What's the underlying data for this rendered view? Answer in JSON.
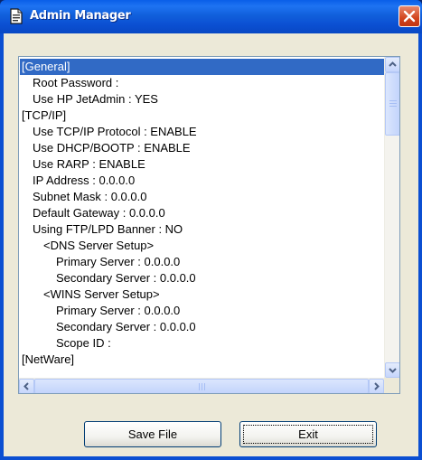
{
  "window": {
    "title": "Admin Manager",
    "colors": {
      "titlebar": "#0b4fd2",
      "selection": "#316ac5",
      "client": "#ece9d8",
      "close": "#d2451e"
    },
    "icons": {
      "title": "document-icon",
      "close": "close-icon"
    }
  },
  "list": {
    "items": [
      {
        "text": "[General]",
        "level": 0,
        "selected": true
      },
      {
        "text": "Root Password :",
        "level": 1
      },
      {
        "text": "Use HP JetAdmin : YES",
        "level": 1
      },
      {
        "text": "[TCP/IP]",
        "level": 0
      },
      {
        "text": "Use TCP/IP Protocol : ENABLE",
        "level": 1
      },
      {
        "text": "Use DHCP/BOOTP : ENABLE",
        "level": 1
      },
      {
        "text": "Use RARP : ENABLE",
        "level": 1
      },
      {
        "text": "IP Address : 0.0.0.0",
        "level": 1
      },
      {
        "text": "Subnet Mask : 0.0.0.0",
        "level": 1
      },
      {
        "text": "Default Gateway : 0.0.0.0",
        "level": 1
      },
      {
        "text": "Using FTP/LPD Banner : NO",
        "level": 1
      },
      {
        "text": "<DNS Server Setup>",
        "level": 2
      },
      {
        "text": "Primary Server : 0.0.0.0",
        "level": 3
      },
      {
        "text": "Secondary Server : 0.0.0.0",
        "level": 3
      },
      {
        "text": "<WINS Server Setup>",
        "level": 2
      },
      {
        "text": "Primary Server : 0.0.0.0",
        "level": 3
      },
      {
        "text": "Secondary Server : 0.0.0.0",
        "level": 3
      },
      {
        "text": "Scope ID :",
        "level": 3
      },
      {
        "text": "[NetWare]",
        "level": 0
      }
    ]
  },
  "buttons": {
    "save": "Save File",
    "exit": "Exit"
  }
}
